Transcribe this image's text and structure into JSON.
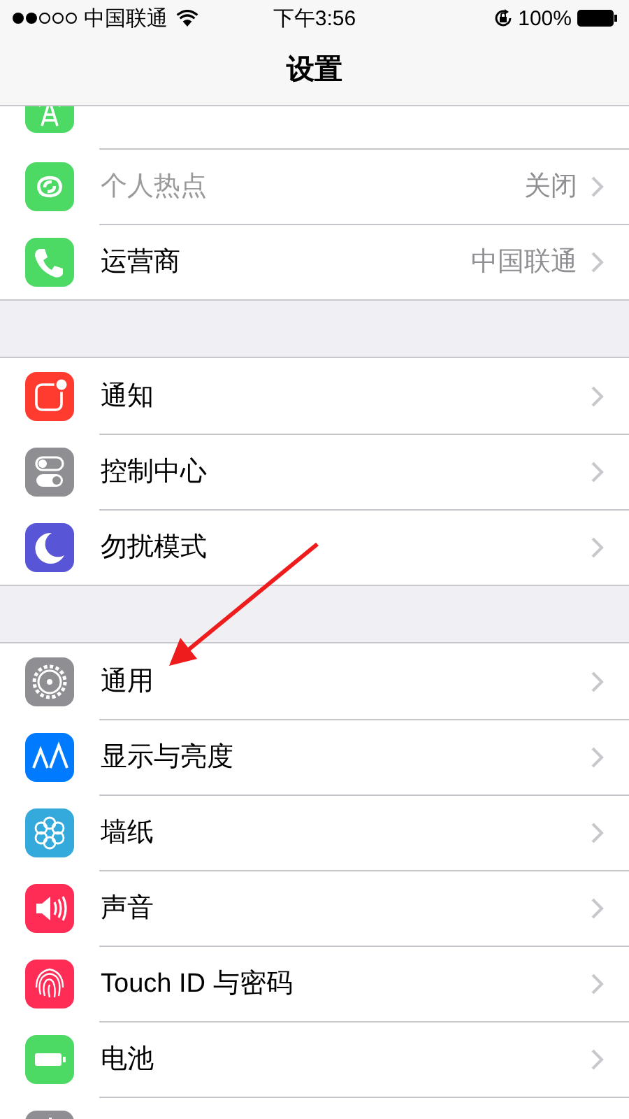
{
  "status_bar": {
    "carrier": "中国联通",
    "time": "下午3:56",
    "battery": "100%"
  },
  "nav_bar": {
    "title": "设置"
  },
  "groups": [
    {
      "rows": [
        {
          "kind": "cellular",
          "color": "#4cd964"
        },
        {
          "kind": "hotspot",
          "color": "#4cd964",
          "label": "个人热点",
          "value": "关闭",
          "disabled": true
        },
        {
          "kind": "phone",
          "color": "#4cd964",
          "label": "运营商",
          "value": "中国联通",
          "disabled": false
        }
      ]
    },
    {
      "rows": [
        {
          "kind": "notifications",
          "color": "#ff3b30",
          "label": "通知",
          "disabled": false
        },
        {
          "kind": "toggles",
          "color": "#8e8e93",
          "label": "控制中心",
          "disabled": false
        },
        {
          "kind": "moon",
          "color": "#5856d6",
          "label": "勿扰模式",
          "disabled": false
        }
      ]
    },
    {
      "rows": [
        {
          "kind": "gear",
          "color": "#8e8e93",
          "label": "通用",
          "disabled": false
        },
        {
          "kind": "display",
          "color": "#007aff",
          "label": "显示与亮度",
          "disabled": false
        },
        {
          "kind": "flower",
          "color": "#34aadc",
          "label": "墙纸",
          "disabled": false
        },
        {
          "kind": "speaker",
          "color": "#ff2d55",
          "label": "声音",
          "disabled": false
        },
        {
          "kind": "fingerprint",
          "color": "#ff2d55",
          "label": "Touch ID 与密码",
          "disabled": false
        },
        {
          "kind": "battery",
          "color": "#4cd964",
          "label": "电池",
          "disabled": false
        },
        {
          "kind": "partial",
          "color": "#8e8e93"
        }
      ]
    }
  ],
  "annotations": [
    {
      "kind": "arrow"
    }
  ]
}
